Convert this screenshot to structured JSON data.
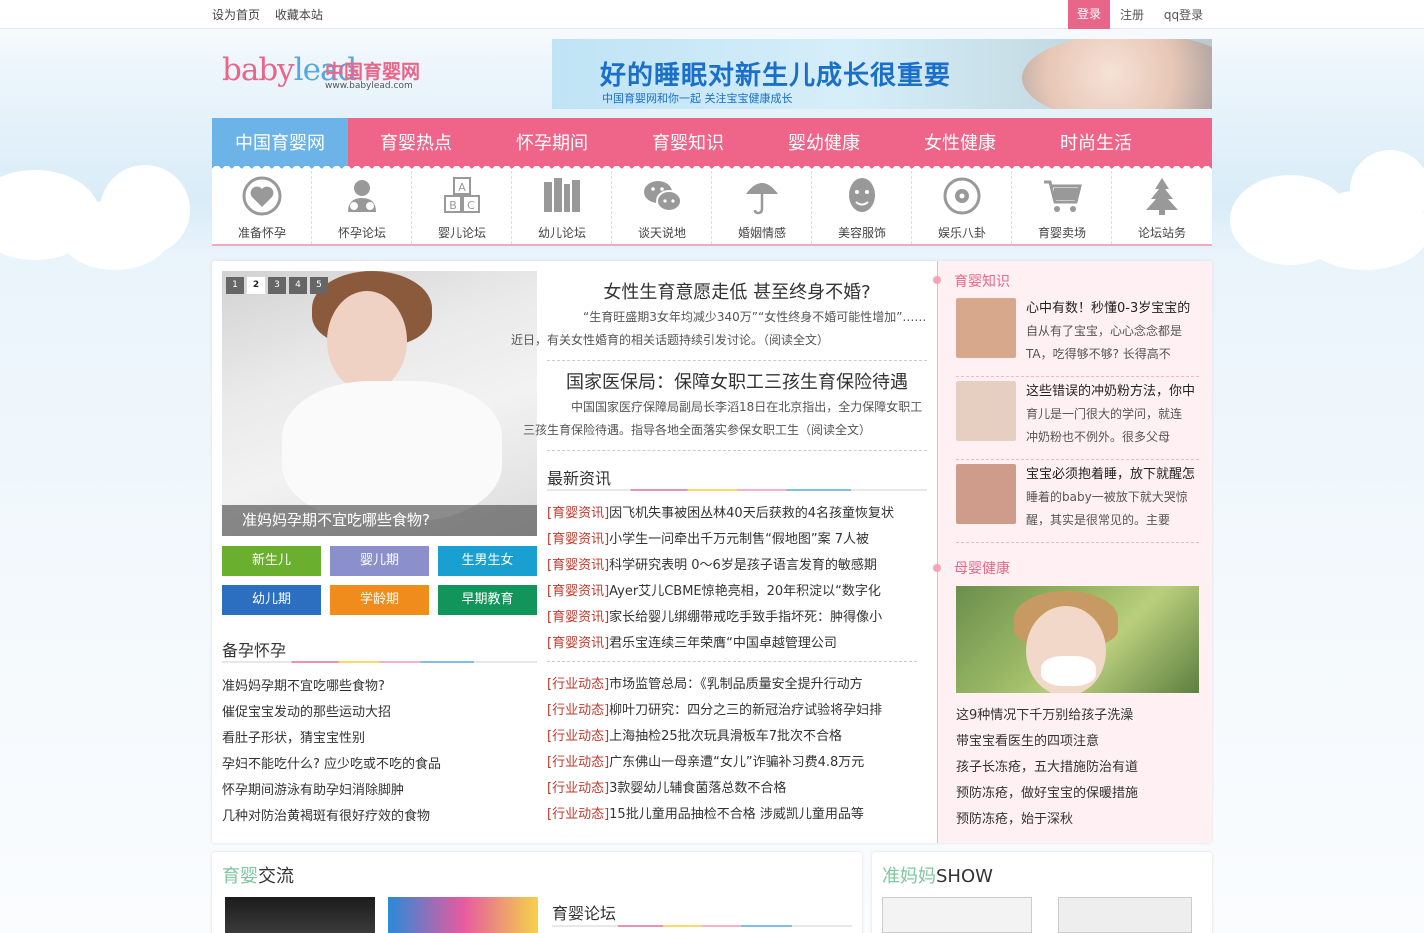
{
  "topbar": {
    "set_home": "设为首页",
    "bookmark": "收藏本站",
    "login": "登录",
    "register": "注册",
    "qq_login": "qq登录"
  },
  "logo": {
    "en_a": "baby",
    "en_b": "lead",
    "cn": "中国育婴网",
    "url": "www.babylead.com"
  },
  "banner": {
    "title": "好的睡眠对新生儿成长很重要",
    "subtitle": "中国育婴网和你一起  关注宝宝健康成长"
  },
  "nav": [
    "中国育婴网",
    "育婴热点",
    "怀孕期间",
    "育婴知识",
    "婴幼健康",
    "女性健康",
    "时尚生活"
  ],
  "icons": [
    {
      "label": "准备怀孕",
      "icon": "heart-icon"
    },
    {
      "label": "怀孕论坛",
      "icon": "baby-icon"
    },
    {
      "label": "婴儿论坛",
      "icon": "abc-blocks-icon"
    },
    {
      "label": "幼儿论坛",
      "icon": "books-icon"
    },
    {
      "label": "谈天说地",
      "icon": "chat-icon"
    },
    {
      "label": "婚姻情感",
      "icon": "umbrella-icon"
    },
    {
      "label": "美容服饰",
      "icon": "face-icon"
    },
    {
      "label": "娱乐八卦",
      "icon": "disc-icon"
    },
    {
      "label": "育婴卖场",
      "icon": "cart-icon"
    },
    {
      "label": "论坛站务",
      "icon": "tree-icon"
    }
  ],
  "slider": {
    "pages": [
      "1",
      "2",
      "3",
      "4",
      "5"
    ],
    "active": "2",
    "caption": "准妈妈孕期不宜吃哪些食物?"
  },
  "categories": [
    {
      "label": "新生儿",
      "color": "#6aaf2e"
    },
    {
      "label": "婴儿期",
      "color": "#8b8fcb"
    },
    {
      "label": "生男生女",
      "color": "#1a9fd1"
    },
    {
      "label": "幼儿期",
      "color": "#2c6fc0"
    },
    {
      "label": "学龄期",
      "color": "#f08c1c"
    },
    {
      "label": "早期教育",
      "color": "#11955a"
    }
  ],
  "prep": {
    "title": "备孕怀孕",
    "items": [
      "准妈妈孕期不宜吃哪些食物?",
      "催促宝宝发动的那些运动大招",
      "看肚子形状，猜宝宝性别",
      "孕妇不能吃什么? 应少吃或不吃的食品",
      "怀孕期间游泳有助孕妇消除脚肿",
      "几种对防治黄褐斑有很好疗效的食物"
    ]
  },
  "headline1": {
    "title": "女性生育意愿走低 甚至终身不婚?",
    "summary_a": "“生育旺盛期3女年均减少340万”“女性终身不婚可能性增加”……",
    "summary_b": "近日，有关女性婚育的相关话题持续引发讨论。（阅读全文）"
  },
  "headline2": {
    "title": "国家医保局：保障女职工三孩生育保险待遇",
    "summary_a": "中国国家医疗保障局副局长李滔18日在北京指出，全力保障女职工",
    "summary_b": "三孩生育保险待遇。指导各地全面落实参保女职工生（阅读全文）"
  },
  "latest": {
    "title": "最新资讯",
    "news": [
      {
        "tag": "[育婴资讯]",
        "text": "因飞机失事被困丛林40天后获救的4名孩童恢复状"
      },
      {
        "tag": "[育婴资讯]",
        "text": "小学生一问牵出千万元制售“假地图”案 7人被"
      },
      {
        "tag": "[育婴资讯]",
        "text": "科学研究表明 0～6岁是孩子语言发育的敏感期"
      },
      {
        "tag": "[育婴资讯]",
        "text": "Ayer艾儿CBME惊艳亮相，20年积淀以“数字化"
      },
      {
        "tag": "[育婴资讯]",
        "text": "家长给婴儿绑绷带戒吃手致手指坏死：肿得像小"
      },
      {
        "tag": "[育婴资讯]",
        "text": "君乐宝连续三年荣膺“中国卓越管理公司"
      }
    ],
    "industry": [
      {
        "tag": "[行业动态]",
        "text": "市场监管总局：《乳制品质量安全提升行动方"
      },
      {
        "tag": "[行业动态]",
        "text": "柳叶刀研究：四分之三的新冠治疗试验将孕妇排"
      },
      {
        "tag": "[行业动态]",
        "text": "上海抽检25批次玩具滑板车7批次不合格"
      },
      {
        "tag": "[行业动态]",
        "text": "广东佛山一母亲遭“女儿”诈骗补习费4.8万元"
      },
      {
        "tag": "[行业动态]",
        "text": "3款婴幼儿辅食菌落总数不合格"
      },
      {
        "tag": "[行业动态]",
        "text": "15批儿童用品抽检不合格 涉威凯儿童用品等"
      }
    ]
  },
  "knowledge": {
    "title": "育婴知识",
    "items": [
      {
        "title": "心中有数！秒懂0-3岁宝宝的",
        "l1": "自从有了宝宝，心心念念都是",
        "l2": "TA，吃得够不够? 长得高不",
        "thumb": "#d8a88c"
      },
      {
        "title": "这些错误的冲奶粉方法，你中",
        "l1": "育儿是一门很大的学问，就连",
        "l2": "冲奶粉也不例外。很多父母",
        "thumb": "#e6cfc0"
      },
      {
        "title": "宝宝必须抱着睡，放下就醒怎",
        "l1": "睡着的baby一被放下就大哭惊",
        "l2": "醒，其实是很常见的。主要",
        "thumb": "#cf9b8a"
      }
    ]
  },
  "health": {
    "title": "母婴健康",
    "items": [
      "这9种情况下千万别给孩子洗澡",
      "带宝宝看医生的四项注意",
      "孩子长冻疮，五大措施防治有道",
      "预防冻疮，做好宝宝的保暖措施",
      "预防冻疮，始于深秋"
    ]
  },
  "bottom": {
    "exchange_a": "育婴",
    "exchange_b": "交流",
    "forum": "育婴论坛",
    "show_a": "准妈妈",
    "show_b": "SHOW"
  }
}
